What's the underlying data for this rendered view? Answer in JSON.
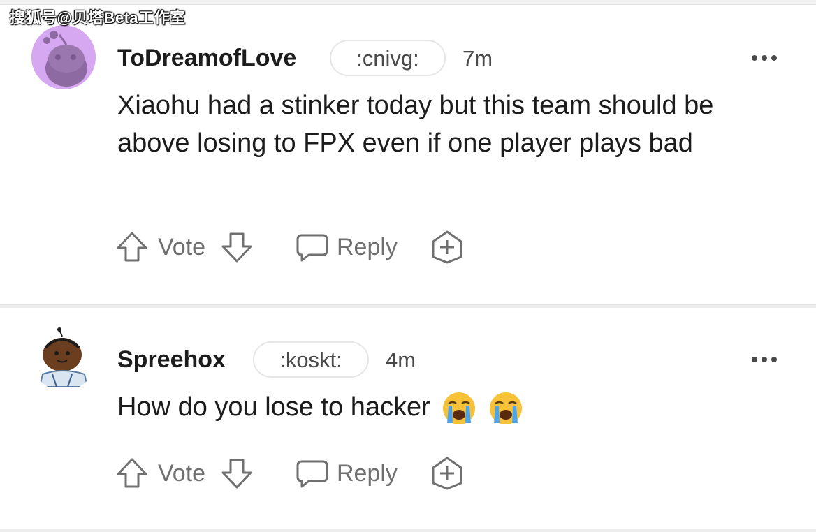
{
  "watermark": "搜狐号@贝塔Beta工作室",
  "comments": [
    {
      "username": "ToDreamofLove",
      "flair": ":cnivg:",
      "time": "7m",
      "body": "Xiaohu had a stinker today but this team should be above losing to FPX even if one player plays bad",
      "avatar_icon": "snoo-avatar-purple",
      "avatar_bg": "#d7a8f2",
      "vote_label": "Vote",
      "reply_label": "Reply"
    },
    {
      "username": "Spreehox",
      "flair": ":koskt:",
      "time": "4m",
      "body": "How do you lose to hacker",
      "body_emojis": [
        "loudly-crying-face",
        "loudly-crying-face"
      ],
      "avatar_icon": "snoo-avatar-custom",
      "vote_label": "Vote",
      "reply_label": "Reply"
    }
  ],
  "colors": {
    "text": "#1c1c1c",
    "muted": "#707070",
    "divider": "#ededed"
  }
}
